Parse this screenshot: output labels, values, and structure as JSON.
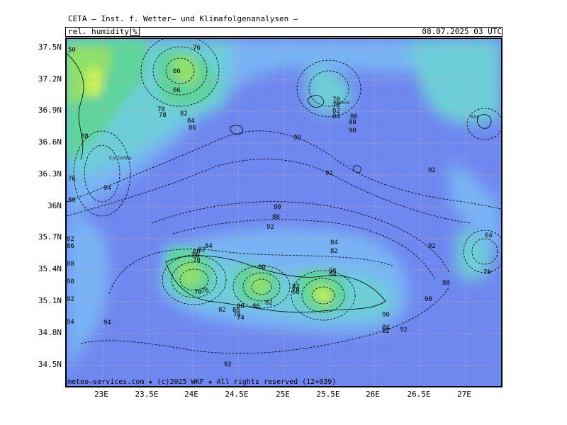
{
  "header": {
    "title": "CETA — Inst. f. Wetter— und Klimafolgenanalysen —",
    "parameter": "rel. humidity",
    "unit": "%",
    "valid_time": "08.07.2025 03 UTC"
  },
  "axes": {
    "lat_labels": [
      "37.5N",
      "37.2N",
      "36.9N",
      "36.6N",
      "36.3N",
      "36N",
      "35.7N",
      "35.4N",
      "35.1N",
      "34.8N",
      "34.5N"
    ],
    "lon_labels": [
      "23E",
      "23.5E",
      "24E",
      "24.5E",
      "25E",
      "25.5E",
      "26E",
      "26.5E",
      "27E"
    ]
  },
  "map": {
    "region": "South Aegean Sea / Crete",
    "colors": {
      "very_humid": "#6f87f0",
      "humid": "#78b4f5",
      "moderate": "#6ccfd8",
      "drier": "#5fd39c",
      "dry": "#8fe06a",
      "driest": "#c8ef5a"
    },
    "contour_labels": [
      "50",
      "76",
      "66",
      "66",
      "70",
      "78",
      "82",
      "84",
      "86",
      "88",
      "90",
      "92",
      "94",
      "70",
      "78",
      "82",
      "84",
      "86",
      "88",
      "90",
      "92",
      "76",
      "80",
      "82",
      "86",
      "88",
      "90",
      "92",
      "94",
      "84",
      "82",
      "80",
      "76",
      "78",
      "90",
      "88",
      "92",
      "84",
      "82",
      "92",
      "88",
      "90",
      "94",
      "92",
      "80",
      "82",
      "76",
      "66",
      "84",
      "90",
      "86",
      "82",
      "78",
      "86",
      "88",
      "82",
      "90",
      "92",
      "84",
      "82",
      "76",
      "64",
      "74",
      "70",
      "76"
    ],
    "place_labels": [
      "Naxos",
      "Cyclades",
      "Kos"
    ]
  },
  "footer": {
    "credit": "meteo—services.com ★ (c)2025 WKF ★ All rights reserved (12+039)"
  }
}
